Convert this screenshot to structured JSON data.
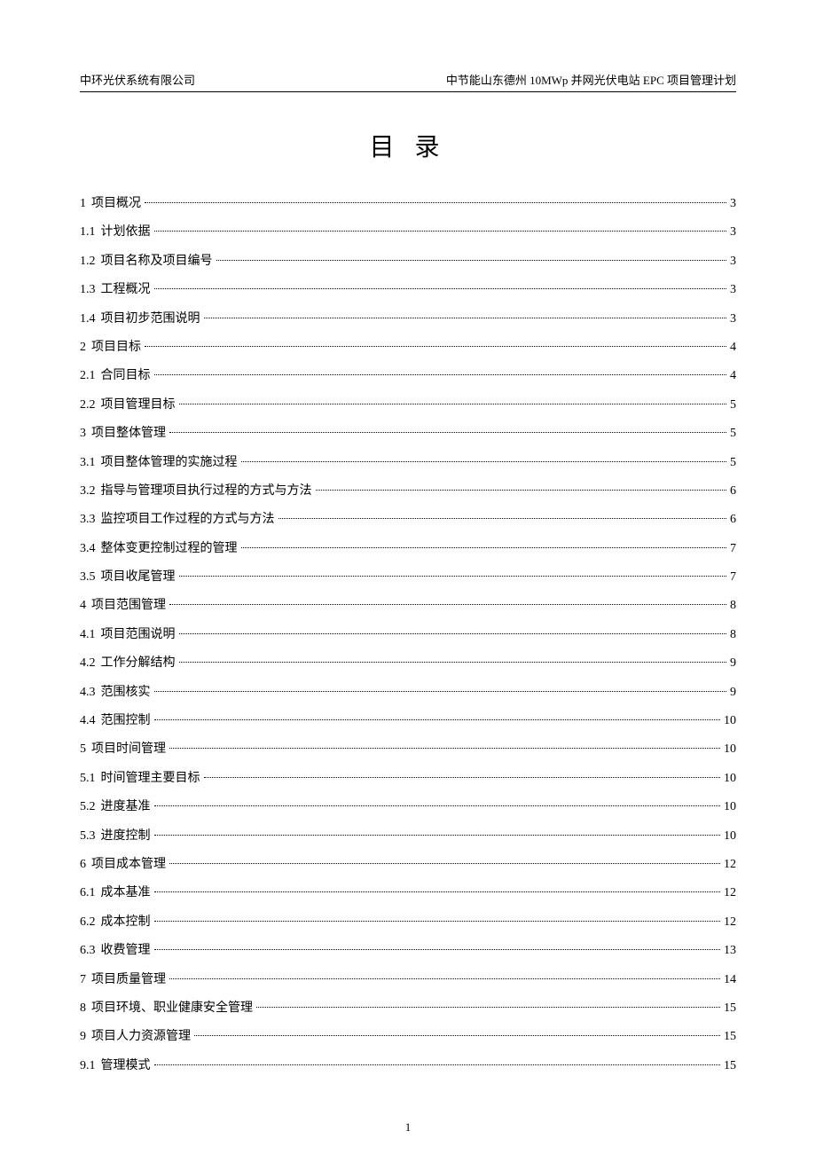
{
  "header": {
    "left": "中环光伏系统有限公司",
    "right": "中节能山东德州 10MWp 并网光伏电站 EPC 项目管理计划"
  },
  "title": "目 录",
  "toc": [
    {
      "num": "1",
      "label": "项目概况",
      "page": "3"
    },
    {
      "num": "1.1",
      "label": "计划依据",
      "page": "3"
    },
    {
      "num": "1.2",
      "label": "项目名称及项目编号",
      "page": "3"
    },
    {
      "num": "1.3",
      "label": "工程概况",
      "page": "3"
    },
    {
      "num": "1.4",
      "label": "项目初步范围说明",
      "page": "3"
    },
    {
      "num": "2",
      "label": "项目目标",
      "page": "4"
    },
    {
      "num": "2.1",
      "label": "合同目标",
      "page": "4"
    },
    {
      "num": "2.2",
      "label": "项目管理目标",
      "page": "5"
    },
    {
      "num": "3",
      "label": "项目整体管理",
      "page": "5"
    },
    {
      "num": "3.1",
      "label": "项目整体管理的实施过程",
      "page": "5"
    },
    {
      "num": "3.2",
      "label": "指导与管理项目执行过程的方式与方法",
      "page": "6"
    },
    {
      "num": "3.3",
      "label": "监控项目工作过程的方式与方法",
      "page": "6"
    },
    {
      "num": "3.4",
      "label": "整体变更控制过程的管理",
      "page": "7"
    },
    {
      "num": "3.5",
      "label": "项目收尾管理",
      "page": "7"
    },
    {
      "num": "4",
      "label": "项目范围管理",
      "page": "8"
    },
    {
      "num": "4.1",
      "label": "项目范围说明",
      "page": "8"
    },
    {
      "num": "4.2",
      "label": "工作分解结构",
      "page": "9"
    },
    {
      "num": "4.3",
      "label": "范围核实",
      "page": "9"
    },
    {
      "num": "4.4",
      "label": "范围控制",
      "page": "10"
    },
    {
      "num": "5",
      "label": "项目时间管理",
      "page": "10"
    },
    {
      "num": "5.1",
      "label": "时间管理主要目标",
      "page": "10"
    },
    {
      "num": "5.2",
      "label": "进度基准",
      "page": "10"
    },
    {
      "num": "5.3",
      "label": "进度控制",
      "page": "10"
    },
    {
      "num": "6",
      "label": "项目成本管理",
      "page": "12"
    },
    {
      "num": "6.1",
      "label": "成本基准",
      "page": "12"
    },
    {
      "num": "6.2",
      "label": "成本控制",
      "page": "12"
    },
    {
      "num": "6.3",
      "label": "收费管理",
      "page": "13"
    },
    {
      "num": "7",
      "label": "项目质量管理",
      "page": "14"
    },
    {
      "num": "8",
      "label": "项目环境、职业健康安全管理",
      "page": "15"
    },
    {
      "num": "9",
      "label": "项目人力资源管理",
      "page": "15"
    },
    {
      "num": "9.1",
      "label": "管理模式",
      "page": "15"
    }
  ],
  "footer": {
    "page_number": "1"
  }
}
